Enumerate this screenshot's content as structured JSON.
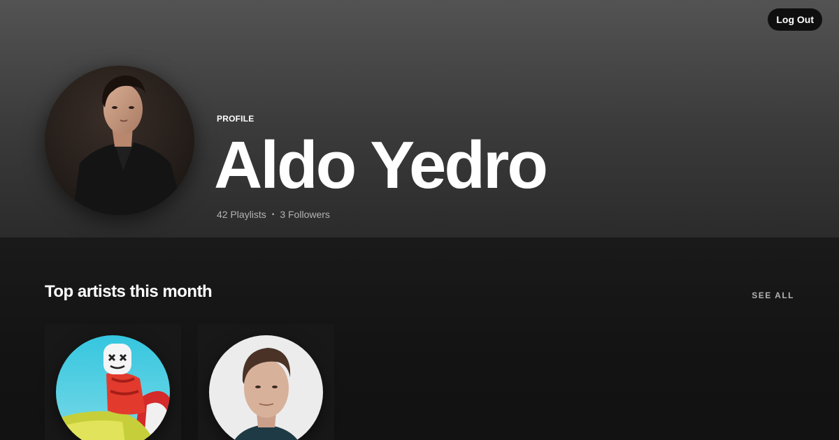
{
  "header": {
    "logout_label": "Log Out"
  },
  "profile": {
    "label": "PROFILE",
    "name": "Aldo Yedro",
    "playlists": "42 Playlists",
    "separator": "•",
    "followers": "3 Followers"
  },
  "top_artists": {
    "title": "Top artists this month",
    "see_all_label": "SEE ALL",
    "items": [
      {
        "image": "artist-marshmello-photo"
      },
      {
        "image": "artist-martin-garrix-photo"
      }
    ]
  },
  "colors": {
    "background": "#121212",
    "hero_top": "#535353",
    "card_bg": "#181818",
    "secondary_text": "#b3b3b3"
  }
}
